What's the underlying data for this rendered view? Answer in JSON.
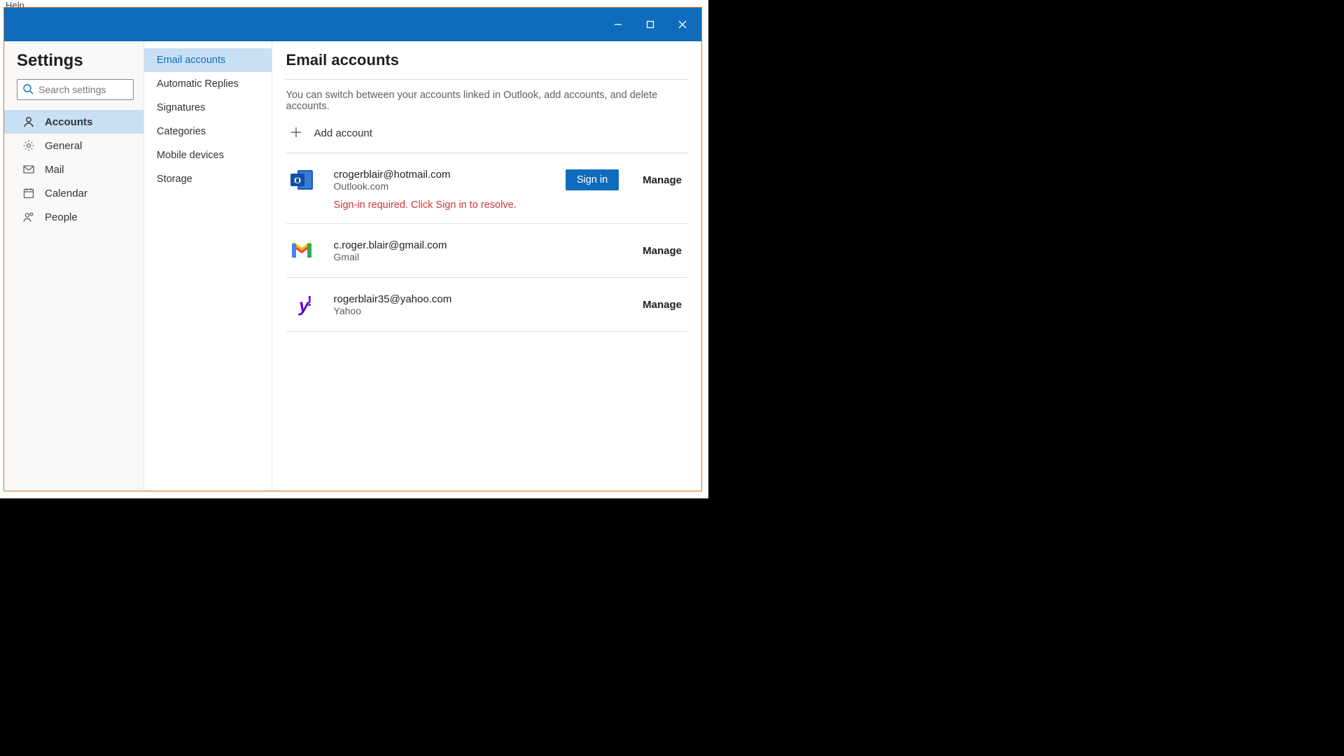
{
  "help_menu": "Help",
  "settings_title": "Settings",
  "search_placeholder": "Search settings",
  "sidebar1": {
    "items": [
      {
        "label": "Accounts",
        "selected": true
      },
      {
        "label": "General",
        "selected": false
      },
      {
        "label": "Mail",
        "selected": false
      },
      {
        "label": "Calendar",
        "selected": false
      },
      {
        "label": "People",
        "selected": false
      }
    ]
  },
  "sidebar2": {
    "items": [
      {
        "label": "Email accounts",
        "selected": true
      },
      {
        "label": "Automatic Replies",
        "selected": false
      },
      {
        "label": "Signatures",
        "selected": false
      },
      {
        "label": "Categories",
        "selected": false
      },
      {
        "label": "Mobile devices",
        "selected": false
      },
      {
        "label": "Storage",
        "selected": false
      }
    ]
  },
  "main": {
    "heading": "Email accounts",
    "description": "You can switch between your accounts linked in Outlook, add accounts, and delete accounts.",
    "add_account_label": "Add account",
    "signin_label": "Sign in",
    "manage_label": "Manage",
    "accounts": [
      {
        "email": "crogerblair@hotmail.com",
        "service": "Outlook.com",
        "error": "Sign-in required. Click Sign in to resolve.",
        "needs_signin": true
      },
      {
        "email": "c.roger.blair@gmail.com",
        "service": "Gmail"
      },
      {
        "email": "rogerblair35@yahoo.com",
        "service": "Yahoo"
      }
    ]
  }
}
